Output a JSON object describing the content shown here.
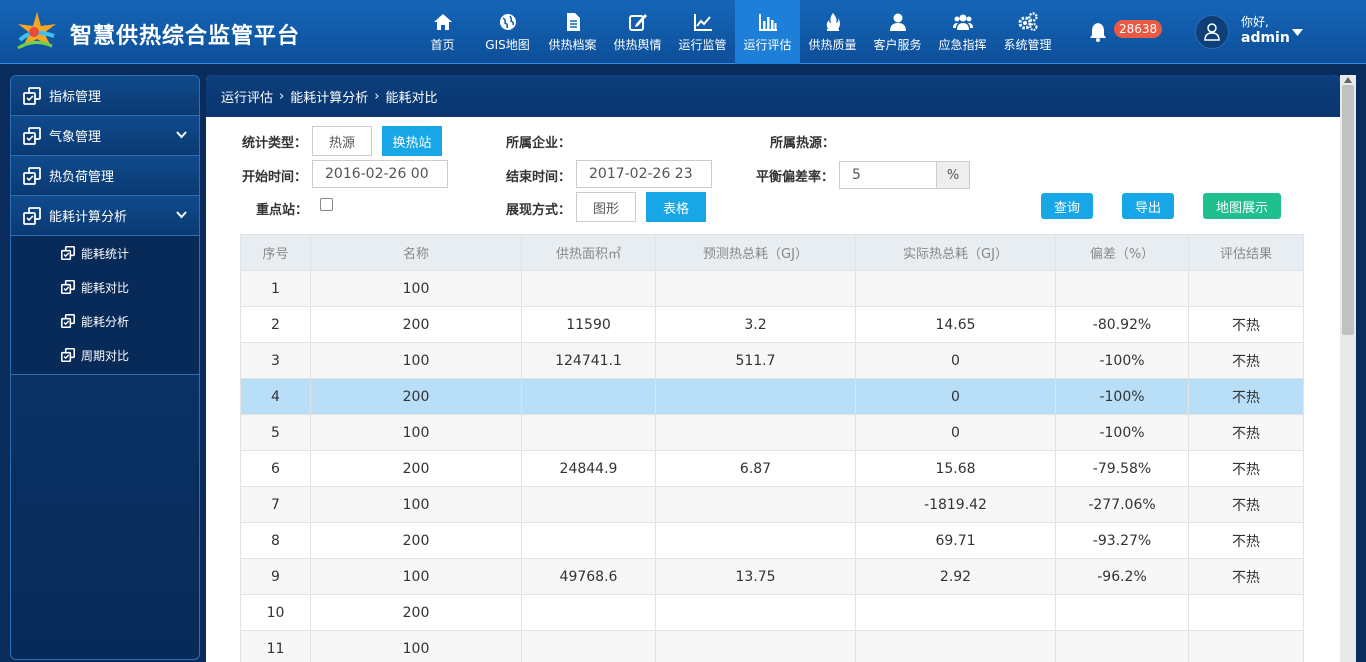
{
  "header": {
    "brand": "智慧供热综合监管平台",
    "nav": [
      {
        "label": "首页",
        "icon": "home-icon"
      },
      {
        "label": "GIS地图",
        "icon": "globe-icon"
      },
      {
        "label": "供热档案",
        "icon": "file-icon"
      },
      {
        "label": "供热舆情",
        "icon": "edit-icon"
      },
      {
        "label": "运行监管",
        "icon": "line-chart-icon"
      },
      {
        "label": "运行评估",
        "icon": "bar-chart-icon",
        "active": true
      },
      {
        "label": "供热质量",
        "icon": "flame-icon"
      },
      {
        "label": "客户服务",
        "icon": "user-icon"
      },
      {
        "label": "应急指挥",
        "icon": "users-icon"
      },
      {
        "label": "系统管理",
        "icon": "cogs-icon"
      }
    ],
    "notification_count": "28638",
    "greeting": "你好,",
    "username": "admin"
  },
  "sidebar": {
    "items": [
      {
        "label": "指标管理",
        "has_chevron": false
      },
      {
        "label": "气象管理",
        "has_chevron": true
      },
      {
        "label": "热负荷管理",
        "has_chevron": false
      },
      {
        "label": "能耗计算分析",
        "has_chevron": true
      }
    ],
    "subitems": [
      {
        "label": "能耗统计"
      },
      {
        "label": "能耗对比"
      },
      {
        "label": "能耗分析"
      },
      {
        "label": "周期对比"
      }
    ]
  },
  "breadcrumb": [
    "运行评估",
    "能耗计算分析",
    "能耗对比"
  ],
  "filters": {
    "stat_type_label": "统计类型：",
    "stat_type_options": [
      "热源",
      "换热站"
    ],
    "company_label": "所属企业：",
    "heat_source_label": "所属热源：",
    "start_label": "开始时间：",
    "start_value": "2016-02-26 00",
    "end_label": "结束时间：",
    "end_value": "2017-02-26 23",
    "deviation_label": "平衡偏差率：",
    "deviation_value": "5",
    "deviation_unit": "%",
    "key_station_label": "重点站：",
    "display_label": "展现方式：",
    "display_options": [
      "图形",
      "表格"
    ],
    "query_button": "查询",
    "export_button": "导出",
    "map_button": "地图展示"
  },
  "table": {
    "columns": [
      "序号",
      "名称",
      "供热面积㎡",
      "预测热总耗（GJ）",
      "实际热总耗（GJ）",
      "偏差（%）",
      "评估结果"
    ],
    "rows": [
      [
        "1",
        "100",
        "",
        "",
        "",
        "",
        ""
      ],
      [
        "2",
        "200",
        "11590",
        "3.2",
        "14.65",
        "-80.92%",
        "不热"
      ],
      [
        "3",
        "100",
        "124741.1",
        "511.7",
        "0",
        "-100%",
        "不热"
      ],
      [
        "4",
        "200",
        "",
        "",
        "0",
        "-100%",
        "不热"
      ],
      [
        "5",
        "100",
        "",
        "",
        "0",
        "-100%",
        "不热"
      ],
      [
        "6",
        "200",
        "24844.9",
        "6.87",
        "15.68",
        "-79.58%",
        "不热"
      ],
      [
        "7",
        "100",
        "",
        "",
        "-1819.42",
        "-277.06%",
        "不热"
      ],
      [
        "8",
        "200",
        "",
        "",
        "69.71",
        "-93.27%",
        "不热"
      ],
      [
        "9",
        "100",
        "49768.6",
        "13.75",
        "2.92",
        "-96.2%",
        "不热"
      ],
      [
        "10",
        "200",
        "",
        "",
        "",
        "",
        ""
      ],
      [
        "11",
        "100",
        "",
        "",
        "",
        "",
        ""
      ]
    ],
    "selected_row": 4
  },
  "colors": {
    "accent": "#17a7e6",
    "nav_active": "#1d7fd8",
    "topbar": "#1566b8",
    "sidebar": "#0b3a72",
    "badge": "#e95a45",
    "map_button": "#1fbf8f"
  }
}
